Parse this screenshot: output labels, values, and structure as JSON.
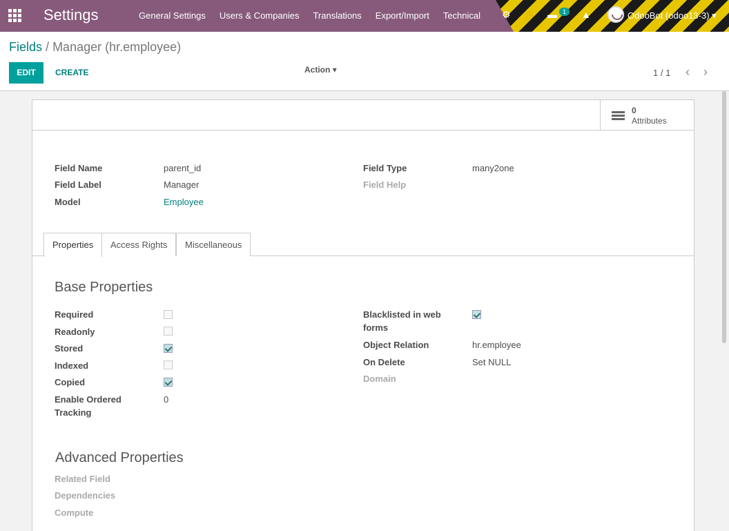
{
  "navbar": {
    "brand": "Settings",
    "menu": [
      "General Settings",
      "Users & Companies",
      "Translations",
      "Export/Import",
      "Technical"
    ],
    "messages_count": "1",
    "user": "OdooBot (odoo13-3)",
    "colors": {
      "navbar_bg": "#875a7b",
      "accent": "#00a09d"
    }
  },
  "breadcrumb": {
    "parent": "Fields",
    "separator": "/",
    "current": "Manager (hr.employee)"
  },
  "toolbar": {
    "edit_label": "EDIT",
    "create_label": "CREATE",
    "action_label": "Action",
    "pager": "1 / 1"
  },
  "button_box": {
    "attributes_count": "0",
    "attributes_label": "Attributes"
  },
  "fields": {
    "field_name_label": "Field Name",
    "field_name": "parent_id",
    "field_label_label": "Field Label",
    "field_label": "Manager",
    "model_label": "Model",
    "model": "Employee",
    "field_type_label": "Field Type",
    "field_type": "many2one",
    "field_help_label": "Field Help"
  },
  "tabs": [
    "Properties",
    "Access Rights",
    "Miscellaneous"
  ],
  "base_properties": {
    "title": "Base Properties",
    "required_label": "Required",
    "required": false,
    "readonly_label": "Readonly",
    "readonly": false,
    "stored_label": "Stored",
    "stored": true,
    "indexed_label": "Indexed",
    "indexed": false,
    "copied_label": "Copied",
    "copied": true,
    "tracking_label_1": "Enable Ordered",
    "tracking_label_2": "Tracking",
    "tracking": "0",
    "blacklisted_label_1": "Blacklisted in web",
    "blacklisted_label_2": "forms",
    "blacklisted": true,
    "relation_label": "Object Relation",
    "relation": "hr.employee",
    "on_delete_label": "On Delete",
    "on_delete": "Set NULL",
    "domain_label": "Domain"
  },
  "advanced_properties": {
    "title": "Advanced Properties",
    "related_label": "Related Field",
    "dependencies_label": "Dependencies",
    "compute_label": "Compute"
  }
}
